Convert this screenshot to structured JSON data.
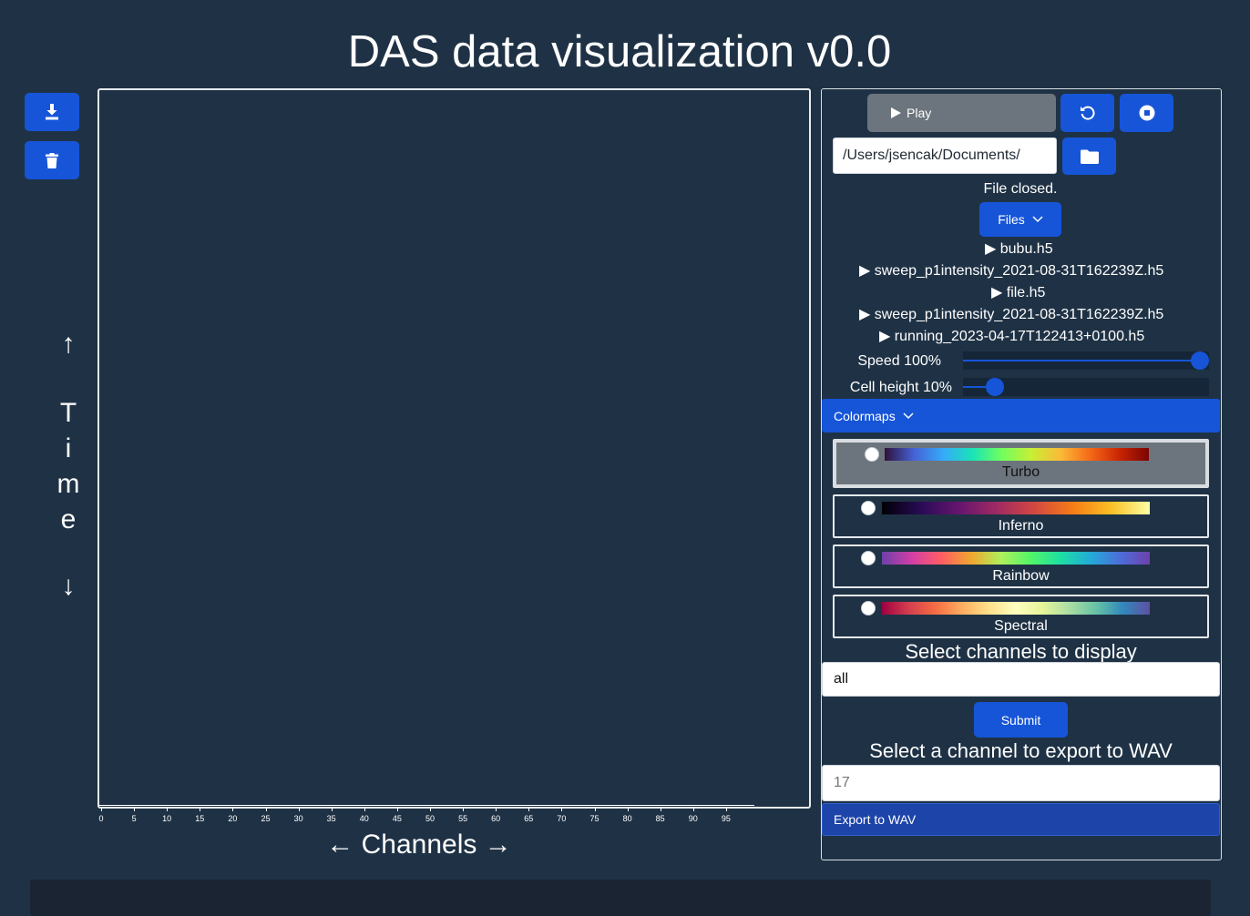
{
  "header": {
    "title": "DAS data visualization v0.0"
  },
  "left_toolbar": {
    "download_icon": "download-icon",
    "delete_icon": "trash-icon",
    "time_arrow_up": "↑",
    "time_letters": [
      "T",
      "i",
      "m",
      "e"
    ],
    "time_arrow_down": "↓"
  },
  "plot": {
    "x_ticks": [
      "0",
      "5",
      "10",
      "15",
      "20",
      "25",
      "30",
      "35",
      "40",
      "45",
      "50",
      "55",
      "60",
      "65",
      "70",
      "75",
      "80",
      "85",
      "90",
      "95"
    ],
    "x_label": "← Channels →"
  },
  "controls": {
    "play_label": "Play",
    "reset_icon": "rotate-icon",
    "stop_icon": "stop-circle-icon",
    "folder_icon": "folder-icon",
    "path_value": "/Users/jsencak/Documents/",
    "status": "File closed.",
    "files_label": "Files",
    "files": [
      "bubu.h5",
      "sweep_p1intensity_2021-08-31T162239Z.h5",
      "file.h5",
      "sweep_p1intensity_2021-08-31T162239Z.h5",
      "running_2023-04-17T122413+0100.h5"
    ],
    "speed_label": "Speed 100%",
    "speed_value": 1.0,
    "cell_height_label": "Cell height 10%",
    "cell_height_value": 0.1,
    "colormaps_label": "Colormaps",
    "colormaps": [
      {
        "name": "Turbo",
        "selected": true
      },
      {
        "name": "Inferno",
        "selected": false
      },
      {
        "name": "Rainbow",
        "selected": false
      },
      {
        "name": "Spectral",
        "selected": false
      }
    ],
    "channels_title": "Select channels to display",
    "channels_value": "all",
    "submit_label": "Submit",
    "wav_title": "Select a channel to export to WAV",
    "wav_placeholder": "17",
    "export_label": "Export to WAV"
  },
  "colors": {
    "accent": "#1655d8",
    "background": "#1f3245",
    "secondary": "#6c757d"
  }
}
